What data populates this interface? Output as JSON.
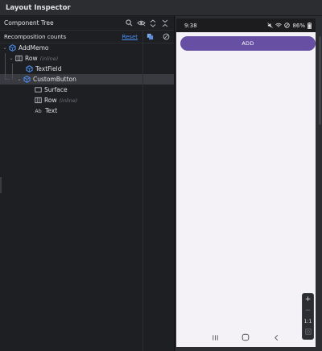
{
  "window": {
    "title": "Layout Inspector"
  },
  "component_tree": {
    "title": "Component Tree",
    "toolbar_icons": [
      "search-icon",
      "eye-icon",
      "expand-icon",
      "collapse-icon"
    ]
  },
  "recomposition": {
    "label": "Recomposition counts",
    "reset_label": "Reset",
    "icons": [
      "copy-icon",
      "block-icon"
    ]
  },
  "tree": {
    "nodes": [
      {
        "label": "AddMemo",
        "hint": "",
        "icon": "compose-icon",
        "depth": 0,
        "expanded": true,
        "selected": false
      },
      {
        "label": "Row",
        "hint": "(inline)",
        "icon": "row-icon",
        "depth": 1,
        "expanded": true,
        "selected": false
      },
      {
        "label": "TextField",
        "hint": "",
        "icon": "compose-icon",
        "depth": 2,
        "expanded": false,
        "selected": false
      },
      {
        "label": "CustomButton",
        "hint": "",
        "icon": "compose-icon",
        "depth": 2,
        "expanded": true,
        "selected": true
      },
      {
        "label": "Surface",
        "hint": "",
        "icon": "surface-icon",
        "depth": 3,
        "expanded": false,
        "selected": false
      },
      {
        "label": "Row",
        "hint": "(inline)",
        "icon": "row-icon",
        "depth": 3,
        "expanded": false,
        "selected": false
      },
      {
        "label": "Text",
        "hint": "",
        "icon": "text-icon",
        "depth": 3,
        "expanded": false,
        "selected": false
      }
    ]
  },
  "device": {
    "status": {
      "time": "9:38",
      "battery": "86%"
    },
    "add_button_label": "ADD",
    "nav_icons": [
      "recents-icon",
      "home-icon",
      "back-icon"
    ]
  },
  "zoom": {
    "plus": "+",
    "minus": "−",
    "ratio": "1:1",
    "fit_icon": "fit-icon"
  },
  "colors": {
    "accent_purple": "#6750a4",
    "compose_icon": "#4e8ff5",
    "link": "#4e8ff5",
    "selected_row": "#393b40"
  }
}
